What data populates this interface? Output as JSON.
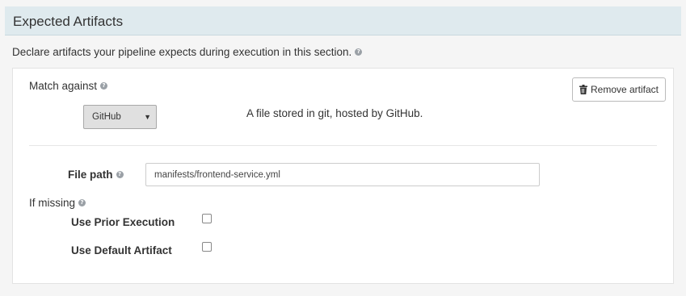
{
  "section": {
    "title": "Expected Artifacts",
    "description": "Declare artifacts your pipeline expects during execution in this section."
  },
  "artifact": {
    "match_label": "Match against",
    "remove_label": "Remove artifact",
    "type_selected": "GitHub",
    "type_description": "A file stored in git, hosted by GitHub.",
    "file_path_label": "File path",
    "file_path_value": "manifests/frontend-service.yml",
    "if_missing_label": "If missing",
    "options": [
      {
        "label": "Use Prior Execution",
        "checked": false
      },
      {
        "label": "Use Default Artifact",
        "checked": false
      }
    ]
  },
  "icons": {
    "help": "question-circle-icon",
    "trash": "trash-icon",
    "caret": "caret-down-icon"
  }
}
